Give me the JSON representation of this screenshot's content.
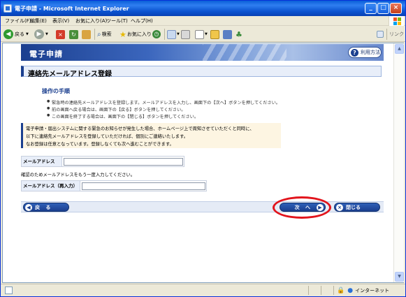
{
  "window": {
    "title": "電子申請 - Microsoft Internet Explorer"
  },
  "menu": {
    "items": [
      "ファイル(F)",
      "編集(E)",
      "表示(V)",
      "お気に入り(A)",
      "ツール(T)",
      "ヘルプ(H)"
    ]
  },
  "toolbar": {
    "back_label": "戻る",
    "search_label": "検索",
    "favorites_label": "お気に入り",
    "links_label": "リンク"
  },
  "page": {
    "banner_title": "電子申請",
    "help_label": "利用方法",
    "heading": "連絡先メールアドレス登録",
    "steps_title": "操作の手順",
    "steps": [
      "緊急時の連絡先メールアドレスを登録します。メールアドレスを入力し、画面下の【次へ】ボタンを押してください。",
      "前の画面へ戻る場合は、画面下の【戻る】ボタンを押してください。",
      "この画面を終了する場合は、画面下の【閉じる】ボタンを押してください。"
    ],
    "notice_lines": [
      "電子申請・届出システムに関する緊急のお知らせが発生した場合、ホームページ上で周知させていただくと同時に、",
      "以下に連絡先メールアドレスを登録していただければ、個別にご連絡いたします。",
      "なお登録は任意となっています。登録しなくても次へ進むことができます。"
    ],
    "email_label": "メールアドレス",
    "email_value": "",
    "confirm_note": "確認のためメールアドレスをもう一度入力してください。",
    "email_confirm_label": "メールアドレス（再入力）",
    "email_confirm_value": "",
    "back_button": "戻 る",
    "next_button": "次 へ",
    "close_button": "閉じる"
  },
  "status": {
    "zone": "インターネット"
  },
  "colors": {
    "brand_navy": "#1b3f8f",
    "highlight_ring": "#e2141c",
    "notice_bg": "#fdf5e2"
  }
}
